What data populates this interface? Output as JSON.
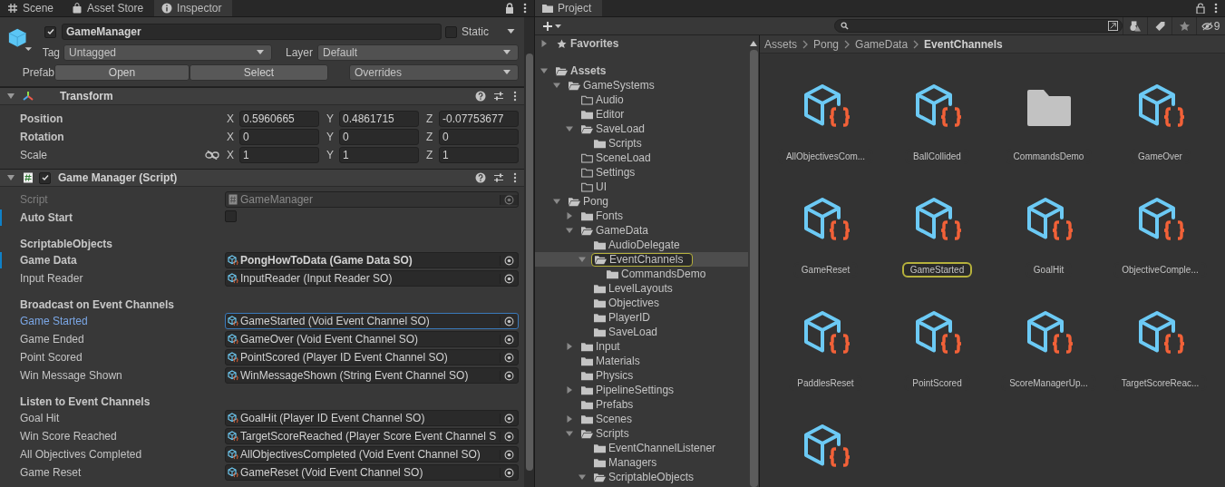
{
  "inspector": {
    "tabs": [
      {
        "label": "Scene",
        "selected": false
      },
      {
        "label": "Asset Store",
        "selected": false
      },
      {
        "label": "Inspector",
        "selected": true
      }
    ],
    "game_object": {
      "active": true,
      "name": "GameManager",
      "static_label": "Static",
      "static": false,
      "tag_label": "Tag",
      "tag": "Untagged",
      "layer_label": "Layer",
      "layer": "Default"
    },
    "prefab": {
      "label": "Prefab",
      "buttons": [
        "Open",
        "Select"
      ],
      "overrides": "Overrides"
    },
    "transform": {
      "title": "Transform",
      "expanded": true,
      "rows": [
        {
          "label": "Position",
          "overridden": true,
          "linked": false,
          "values": [
            {
              "axis": "X",
              "value": "0.5960665"
            },
            {
              "axis": "Y",
              "value": "0.4861715"
            },
            {
              "axis": "Z",
              "value": "-0.07753677"
            }
          ]
        },
        {
          "label": "Rotation",
          "overridden": true,
          "linked": false,
          "values": [
            {
              "axis": "X",
              "value": "0"
            },
            {
              "axis": "Y",
              "value": "0"
            },
            {
              "axis": "Z",
              "value": "0"
            }
          ]
        },
        {
          "label": "Scale",
          "overridden": false,
          "linked": true,
          "values": [
            {
              "axis": "X",
              "value": "1"
            },
            {
              "axis": "Y",
              "value": "1"
            },
            {
              "axis": "Z",
              "value": "1"
            }
          ]
        }
      ]
    },
    "script_component": {
      "title": "Game Manager (Script)",
      "enabled": true,
      "expanded": true,
      "script": {
        "label": "Script",
        "value": "GameManager"
      },
      "auto_start": {
        "label": "Auto Start",
        "checked": false,
        "overridden": true
      },
      "sections": [
        {
          "header": "ScriptableObjects",
          "fields": [
            {
              "label": "Game Data",
              "value": "PongHowToData (Game Data SO)",
              "overridden": true,
              "selected": false
            },
            {
              "label": "Input Reader",
              "value": "InputReader (Input Reader SO)",
              "overridden": false,
              "selected": false
            }
          ]
        },
        {
          "header": "Broadcast on Event Channels",
          "fields": [
            {
              "label": "Game Started",
              "value": "GameStarted (Void Event Channel SO)",
              "overridden": false,
              "selected": true
            },
            {
              "label": "Game Ended",
              "value": "GameOver (Void Event Channel SO)",
              "overridden": false,
              "selected": false
            },
            {
              "label": "Point Scored",
              "value": "PointScored (Player ID Event Channel SO)",
              "overridden": false,
              "selected": false
            },
            {
              "label": "Win Message Shown",
              "value": "WinMessageShown (String Event Channel SO)",
              "overridden": false,
              "selected": false
            }
          ]
        },
        {
          "header": "Listen to Event Channels",
          "fields": [
            {
              "label": "Goal Hit",
              "value": "GoalHit (Player ID Event Channel SO)",
              "overridden": false,
              "selected": false
            },
            {
              "label": "Win Score Reached",
              "value": "TargetScoreReached (Player Score Event Channel S",
              "overridden": false,
              "selected": false
            },
            {
              "label": "All Objectives Completed",
              "value": "AllObjectivesCompleted (Void Event Channel SO)",
              "overridden": false,
              "selected": false
            },
            {
              "label": "Game Reset",
              "value": "GameReset (Void Event Channel SO)",
              "overridden": false,
              "selected": false
            }
          ]
        }
      ]
    }
  },
  "project": {
    "tab": "Project",
    "hidden_count": "9",
    "tree": [
      {
        "label": "Favorites",
        "kind": "favorites",
        "expanded": false,
        "selected": false
      },
      {
        "label": "Assets",
        "kind": "folder",
        "expanded": true,
        "selected": false,
        "children": [
          {
            "label": "GameSystems",
            "kind": "folder",
            "expanded": true,
            "selected": false,
            "children": [
              {
                "label": "Audio",
                "kind": "empty_folder",
                "selected": false
              },
              {
                "label": "Editor",
                "kind": "folder",
                "selected": false
              },
              {
                "label": "SaveLoad",
                "kind": "folder",
                "expanded": true,
                "selected": false,
                "children": [
                  {
                    "label": "Scripts",
                    "kind": "folder",
                    "selected": false
                  }
                ]
              },
              {
                "label": "SceneLoad",
                "kind": "empty_folder",
                "selected": false
              },
              {
                "label": "Settings",
                "kind": "empty_folder",
                "selected": false
              },
              {
                "label": "UI",
                "kind": "empty_folder",
                "selected": false
              }
            ]
          },
          {
            "label": "Pong",
            "kind": "folder",
            "expanded": true,
            "selected": false,
            "children": [
              {
                "label": "Fonts",
                "kind": "folder",
                "expanded": false,
                "selected": false
              },
              {
                "label": "GameData",
                "kind": "folder",
                "expanded": true,
                "selected": false,
                "children": [
                  {
                    "label": "AudioDelegate",
                    "kind": "folder",
                    "selected": false
                  },
                  {
                    "label": "EventChannels",
                    "kind": "folder",
                    "expanded": true,
                    "selected": true,
                    "children": [
                      {
                        "label": "CommandsDemo",
                        "kind": "folder",
                        "selected": false
                      }
                    ]
                  },
                  {
                    "label": "LevelLayouts",
                    "kind": "folder",
                    "selected": false
                  },
                  {
                    "label": "Objectives",
                    "kind": "folder",
                    "selected": false
                  },
                  {
                    "label": "PlayerID",
                    "kind": "folder",
                    "selected": false
                  },
                  {
                    "label": "SaveLoad",
                    "kind": "folder",
                    "selected": false
                  }
                ]
              },
              {
                "label": "Input",
                "kind": "folder",
                "expanded": false,
                "selected": false
              },
              {
                "label": "Materials",
                "kind": "folder",
                "selected": false
              },
              {
                "label": "Physics",
                "kind": "folder",
                "selected": false
              },
              {
                "label": "PipelineSettings",
                "kind": "folder",
                "expanded": false,
                "selected": false
              },
              {
                "label": "Prefabs",
                "kind": "folder",
                "selected": false
              },
              {
                "label": "Scenes",
                "kind": "folder",
                "expanded": false,
                "selected": false
              },
              {
                "label": "Scripts",
                "kind": "folder",
                "expanded": true,
                "selected": false,
                "children": [
                  {
                    "label": "EventChannelListener",
                    "kind": "folder",
                    "selected": false
                  },
                  {
                    "label": "Managers",
                    "kind": "folder",
                    "selected": false
                  },
                  {
                    "label": "ScriptableObjects",
                    "kind": "folder",
                    "expanded": true,
                    "selected": false
                  }
                ]
              }
            ]
          }
        ]
      }
    ],
    "breadcrumb": [
      "Assets",
      "Pong",
      "GameData",
      "EventChannels"
    ],
    "assets": [
      {
        "name": "AllObjectivesCom...",
        "kind": "scriptable",
        "selected": false
      },
      {
        "name": "BallCollided",
        "kind": "scriptable",
        "selected": false
      },
      {
        "name": "CommandsDemo",
        "kind": "folder",
        "selected": false
      },
      {
        "name": "GameOver",
        "kind": "scriptable",
        "selected": false
      },
      {
        "name": "GameReset",
        "kind": "scriptable",
        "selected": false
      },
      {
        "name": "GameStarted",
        "kind": "scriptable",
        "selected": true
      },
      {
        "name": "GoalHit",
        "kind": "scriptable",
        "selected": false
      },
      {
        "name": "ObjectiveComple...",
        "kind": "scriptable",
        "selected": false
      },
      {
        "name": "PaddlesReset",
        "kind": "scriptable",
        "selected": false
      },
      {
        "name": "PointScored",
        "kind": "scriptable",
        "selected": false
      },
      {
        "name": "ScoreManagerUp...",
        "kind": "scriptable",
        "selected": false
      },
      {
        "name": "TargetScoreReac...",
        "kind": "scriptable",
        "selected": false
      },
      {
        "kind": "scriptable",
        "selected": false
      }
    ]
  }
}
